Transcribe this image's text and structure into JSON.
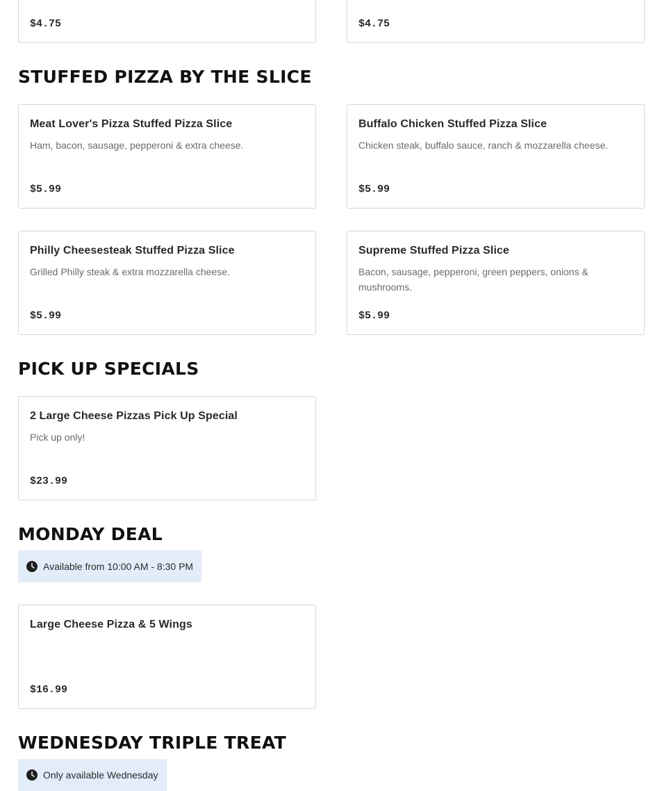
{
  "top_cards": [
    {
      "price": "$4.75"
    },
    {
      "price": "$4.75"
    }
  ],
  "sections": {
    "stuffed_slice": {
      "title": "STUFFED PIZZA BY THE SLICE",
      "items": [
        {
          "name": "Meat Lover's Pizza Stuffed Pizza Slice",
          "desc": "Ham, bacon, sausage, pepperoni & extra cheese.",
          "price": "$5.99"
        },
        {
          "name": "Buffalo Chicken Stuffed Pizza Slice",
          "desc": "Chicken steak, buffalo sauce, ranch & mozzarella cheese.",
          "price": "$5.99"
        },
        {
          "name": "Philly Cheesesteak Stuffed Pizza Slice",
          "desc": "Grilled Philly steak & extra mozzarella cheese.",
          "price": "$5.99"
        },
        {
          "name": "Supreme Stuffed Pizza Slice",
          "desc": "Bacon, sausage, pepperoni, green peppers, onions & mushrooms.",
          "price": "$5.99"
        }
      ]
    },
    "pickup": {
      "title": "PICK UP SPECIALS",
      "items": [
        {
          "name": "2 Large Cheese Pizzas Pick Up Special",
          "desc": "Pick up only!",
          "price": "$23.99"
        }
      ]
    },
    "monday": {
      "title": "MONDAY DEAL",
      "availability": "Available from 10:00 AM - 8:30 PM",
      "items": [
        {
          "name": "Large Cheese Pizza & 5 Wings",
          "price": "$16.99"
        }
      ]
    },
    "wednesday": {
      "title": "WEDNESDAY TRIPLE TREAT",
      "availability": "Only available Wednesday"
    }
  },
  "icons": {
    "clock": "clock-icon"
  },
  "colors": {
    "badge_bg": "#e3edf9",
    "card_border": "#d6d6d6",
    "title": "#111111"
  }
}
